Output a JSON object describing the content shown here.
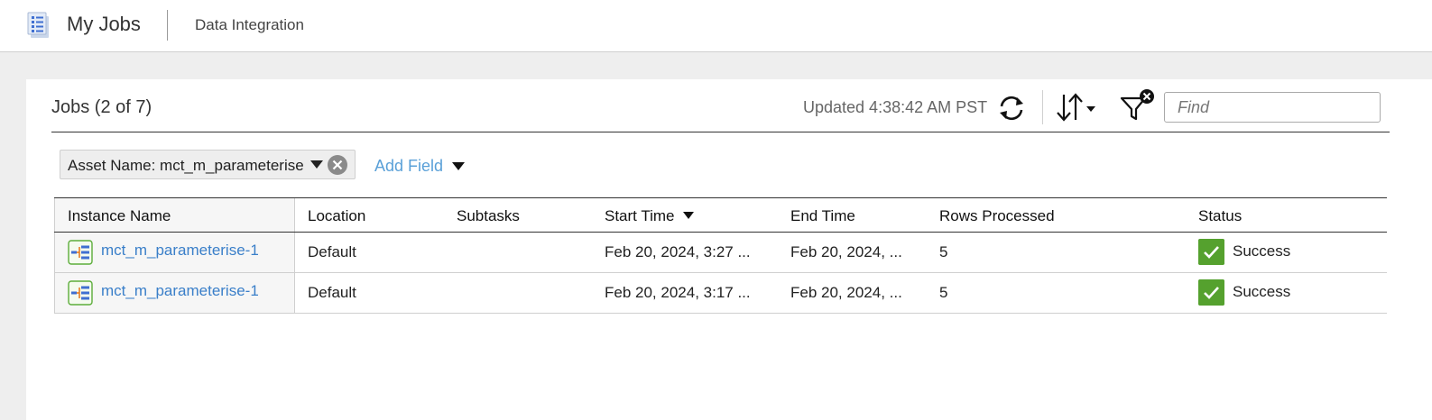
{
  "header": {
    "app_title": "My Jobs",
    "breadcrumb": "Data Integration",
    "app_icon": "document-list-icon"
  },
  "panel": {
    "title": "Jobs (2 of 7)",
    "updated": "Updated 4:38:42 AM PST",
    "find_placeholder": "Find",
    "find_value": ""
  },
  "filters": {
    "chip_label": "Asset Name: mct_m_parameterise",
    "add_field_label": "Add Field"
  },
  "table": {
    "columns": [
      "Instance Name",
      "Location",
      "Subtasks",
      "Start Time",
      "End Time",
      "Rows Processed",
      "Status"
    ],
    "sorted_column": "Start Time",
    "sort_direction": "descending",
    "rows": [
      {
        "instance": "mct_m_parameterise-1",
        "location": "Default",
        "subtasks": "",
        "start": "Feb 20, 2024, 3:27 ...",
        "end": "Feb 20, 2024, ...",
        "rows": "5",
        "status": "Success"
      },
      {
        "instance": "mct_m_parameterise-1",
        "location": "Default",
        "subtasks": "",
        "start": "Feb 20, 2024, 3:17 ...",
        "end": "Feb 20, 2024, ...",
        "rows": "5",
        "status": "Success"
      }
    ]
  },
  "colors": {
    "link": "#3a7fc9",
    "add_field": "#5aa0d8",
    "success": "#55a12e",
    "asset_icon": "#4caf50"
  }
}
